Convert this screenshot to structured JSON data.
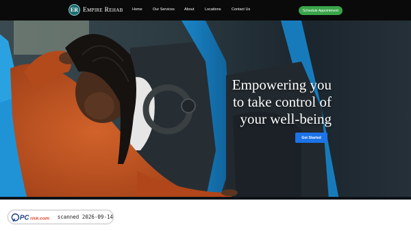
{
  "header": {
    "logo_mark": "ER",
    "brand_name": "Empire Rehab",
    "nav": [
      {
        "label": "Home"
      },
      {
        "label": "Our Services"
      },
      {
        "label": "About"
      },
      {
        "label": "Locations"
      },
      {
        "label": "Contact Us"
      }
    ],
    "cta_label": "Schedule Appointment"
  },
  "hero": {
    "heading_lines": [
      "Empowering you",
      "to take control of",
      "your well-being"
    ],
    "button_label": "Get Started",
    "image": "woman-holding-neck-in-car"
  },
  "watermark": {
    "logo_text": "PCrisk.com",
    "scanned_text": "scanned 2026-09-14"
  },
  "colors": {
    "header_bg": "#0a0a0a",
    "cta_green": "#3aa54a",
    "button_blue": "#1c73e8",
    "car_blue": "#1f8fd0",
    "sweater_orange": "#c0521f"
  }
}
